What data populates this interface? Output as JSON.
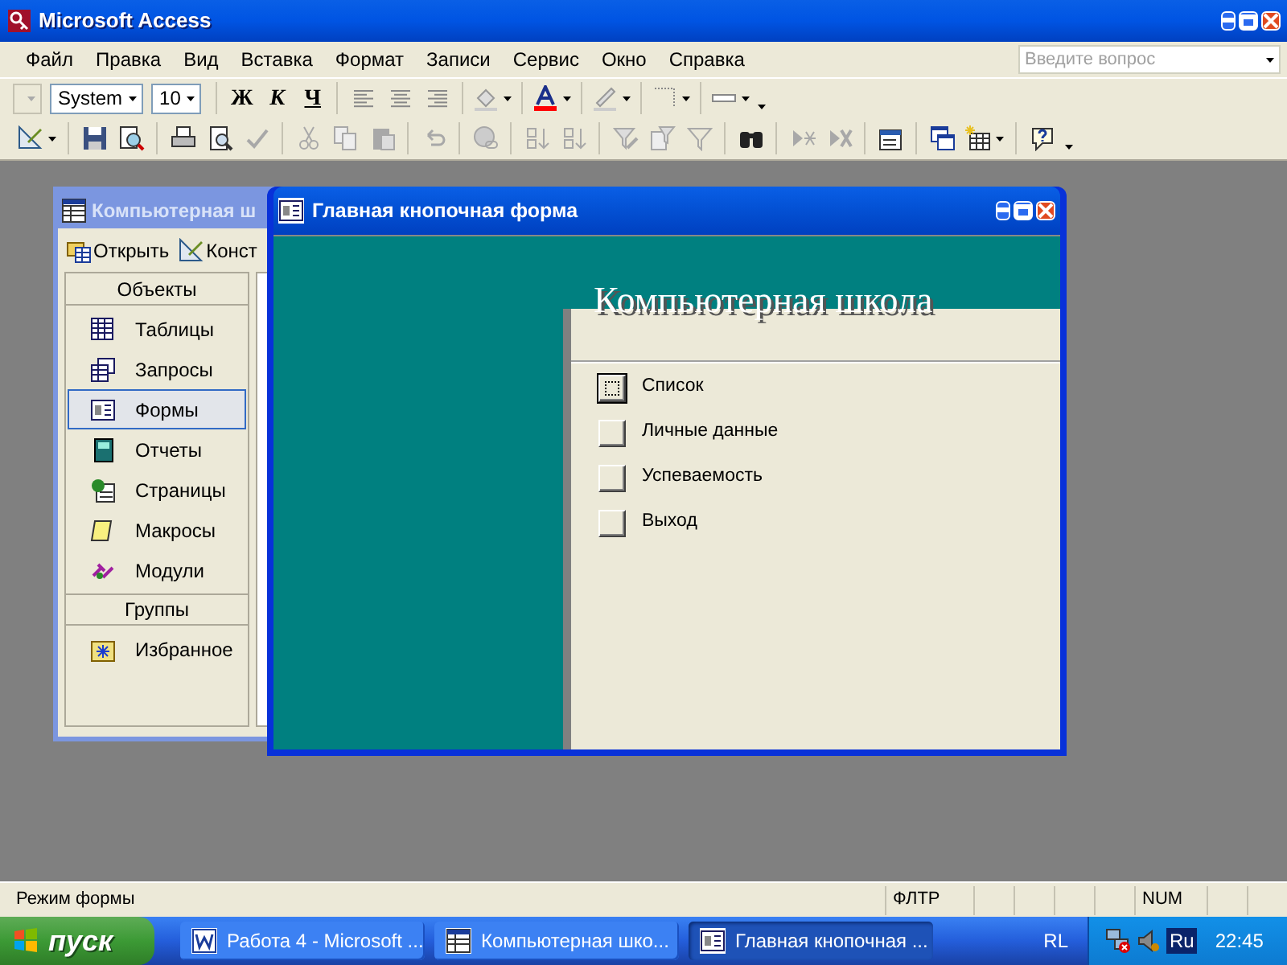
{
  "window": {
    "title": "Microsoft Access"
  },
  "menu": [
    "Файл",
    "Правка",
    "Вид",
    "Вставка",
    "Формат",
    "Записи",
    "Сервис",
    "Окно",
    "Справка"
  ],
  "help_box": {
    "placeholder": "Введите вопрос"
  },
  "formatting_toolbar": {
    "object_box": {
      "disabled": true
    },
    "font": {
      "value": "System"
    },
    "size": {
      "value": "10"
    },
    "style_buttons": [
      "Ж",
      "К",
      "Ч"
    ]
  },
  "database_window": {
    "title": "Компьютерная ш",
    "active": false,
    "toolbar": [
      "Открыть",
      "Конст"
    ],
    "sections": [
      {
        "title": "Объекты",
        "items": [
          {
            "label": "Таблицы",
            "selected": false
          },
          {
            "label": "Запросы",
            "selected": false
          },
          {
            "label": "Формы",
            "selected": true
          },
          {
            "label": "Отчеты",
            "selected": false
          },
          {
            "label": "Страницы",
            "selected": false
          },
          {
            "label": "Макросы",
            "selected": false
          },
          {
            "label": "Модули",
            "selected": false
          }
        ]
      },
      {
        "title": "Группы",
        "items": [
          {
            "label": "Избранное",
            "selected": false
          }
        ]
      }
    ]
  },
  "form_window": {
    "title": "Главная кнопочная форма",
    "active": true,
    "heading": "Компьютерная школа",
    "buttons": [
      {
        "label": "Список",
        "focused": true
      },
      {
        "label": "Личные данные",
        "focused": false
      },
      {
        "label": "Успеваемость",
        "focused": false
      },
      {
        "label": "Выход",
        "focused": false
      }
    ]
  },
  "status_bar": {
    "mode": "Режим формы",
    "panels": [
      {
        "text": "ФЛТР"
      },
      {
        "text": "NUM"
      }
    ]
  },
  "taskbar": {
    "start": "пуск",
    "tasks": [
      {
        "label": "Работа 4 - Microsoft ...",
        "selected": false
      },
      {
        "label": "Компьютерная шко...",
        "selected": false
      },
      {
        "label": "Главная кнопочная ...",
        "selected": true
      }
    ],
    "language_bar": "RL",
    "tray": {
      "language": "Ru",
      "time": "22:45"
    }
  }
}
